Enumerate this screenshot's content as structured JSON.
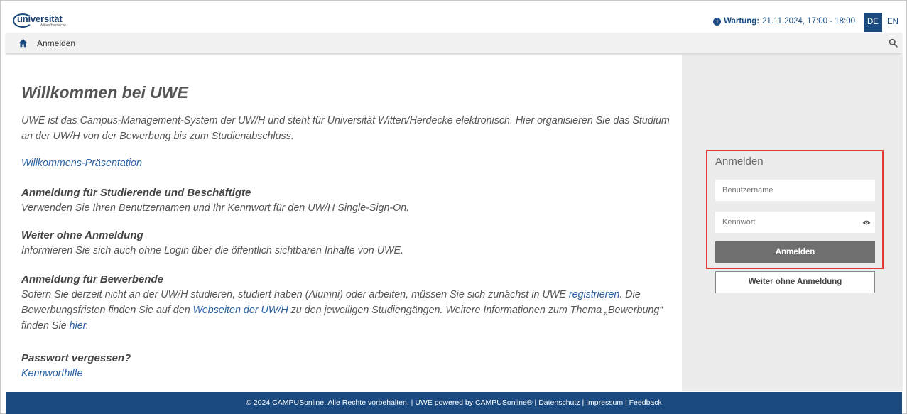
{
  "header": {
    "logo_text": "universität",
    "logo_sub": "Witten/Herdecke",
    "maintenance_label": "Wartung:",
    "maintenance_value": "21.11.2024, 17:00 - 18:00",
    "lang_de": "DE",
    "lang_en": "EN"
  },
  "breadcrumb": {
    "label": "Anmelden"
  },
  "main": {
    "title": "Willkommen bei UWE",
    "intro": "UWE ist das Campus-Management-System der UW/H und steht für Universität Witten/Herdecke elektronisch. Hier organisieren Sie das Studium an der UW/H von der Bewerbung bis zum Studienabschluss.",
    "welcome_link": "Willkommens-Präsentation",
    "sections": [
      {
        "title": "Anmeldung für Studierende und Beschäftigte",
        "text": "Verwenden Sie Ihren Benutzernamen und Ihr Kennwort für den UW/H Single-Sign-On."
      },
      {
        "title": "Weiter ohne Anmeldung",
        "text": "Informieren Sie sich auch ohne Login über die öffentlich sichtbaren Inhalte von UWE."
      },
      {
        "title": "Anmeldung für Bewerbende",
        "text_1": "Sofern Sie derzeit nicht an der UW/H studieren, studiert haben (Alumni) oder arbeiten, müssen Sie sich zunächst in UWE ",
        "link_1": "registrieren",
        "text_2": ". Die Bewerbungsfristen finden Sie auf den ",
        "link_2": "Webseiten der UW/H",
        "text_3": " zu den jeweiligen Studiengängen. Weitere Informationen zum Thema „Bewerbung“ finden Sie ",
        "link_3": "hier",
        "text_4": "."
      },
      {
        "title": "Passwort vergessen?",
        "link": "Kennworthilfe"
      }
    ]
  },
  "login": {
    "title": "Anmelden",
    "username_placeholder": "Benutzername",
    "password_placeholder": "Kennwort",
    "submit_label": "Anmelden",
    "guest_label": "Weiter ohne Anmeldung"
  },
  "footer": {
    "copyright": "© 2024 CAMPUSonline. Alle Rechte vorbehalten.",
    "powered": "UWE powered by CAMPUSonline®",
    "privacy": "Datenschutz",
    "imprint": "Impressum",
    "feedback": "Feedback"
  },
  "colors": {
    "brand_blue": "#1a4a80",
    "link_blue": "#2a62a4",
    "highlight_red": "#e53935",
    "panel_grey": "#ececec"
  }
}
